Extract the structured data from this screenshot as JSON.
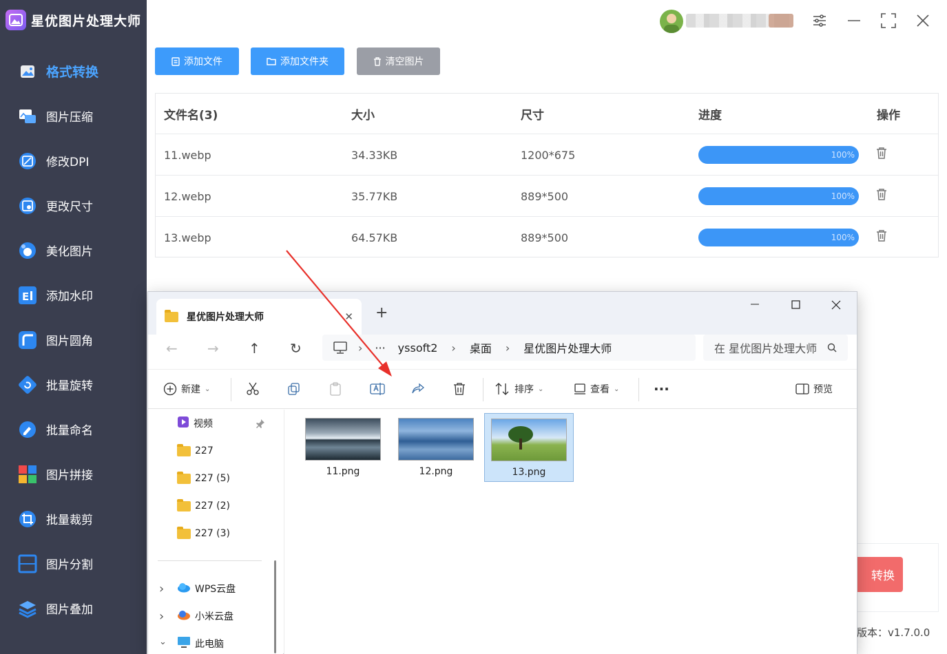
{
  "app": {
    "title": "星优图片处理大师"
  },
  "sidebar": {
    "items": [
      {
        "label": "格式转换",
        "active": true,
        "icon": "image-convert-icon",
        "color": "#3b8ff5"
      },
      {
        "label": "图片压缩",
        "icon": "compress-icon",
        "color": "#3b8ff5"
      },
      {
        "label": "修改DPI",
        "icon": "dpi-icon",
        "color": "#2d87f0"
      },
      {
        "label": "更改尺寸",
        "icon": "resize-icon",
        "color": "#2d87f0"
      },
      {
        "label": "美化图片",
        "icon": "beautify-icon",
        "color": "#2d87f0"
      },
      {
        "label": "添加水印",
        "icon": "watermark-icon",
        "color": "#2d87f0"
      },
      {
        "label": "图片圆角",
        "icon": "round-corner-icon",
        "color": "#2d87f0"
      },
      {
        "label": "批量旋转",
        "icon": "rotate-icon",
        "color": "#2d87f0"
      },
      {
        "label": "批量命名",
        "icon": "rename-icon",
        "color": "#2d87f0"
      },
      {
        "label": "图片拼接",
        "icon": "splice-icon",
        "color": "#f04a4a"
      },
      {
        "label": "批量裁剪",
        "icon": "crop-icon",
        "color": "#2d87f0"
      },
      {
        "label": "图片分割",
        "icon": "split-icon",
        "color": "#2d87f0"
      },
      {
        "label": "图片叠加",
        "icon": "layers-icon",
        "color": "#2d87f0"
      }
    ]
  },
  "toolbar": {
    "add_file": "添加文件",
    "add_folder": "添加文件夹",
    "clear": "清空图片"
  },
  "table": {
    "headers": [
      "文件名(3)",
      "大小",
      "尺寸",
      "进度",
      "操作"
    ],
    "rows": [
      {
        "name": "11.webp",
        "size": "34.33KB",
        "dims": "1200*675",
        "progress": "100%"
      },
      {
        "name": "12.webp",
        "size": "35.77KB",
        "dims": "889*500",
        "progress": "100%"
      },
      {
        "name": "13.webp",
        "size": "64.57KB",
        "dims": "889*500",
        "progress": "100%"
      }
    ]
  },
  "convert_label": "转换",
  "version": "版本：v1.7.0.0",
  "explorer": {
    "tab_title": "星优图片处理大师",
    "new_tab": "+",
    "breadcrumb": [
      "yssoft2",
      "桌面",
      "星优图片处理大师"
    ],
    "search_placeholder": "在 星优图片处理大师",
    "cmd": {
      "new": "新建",
      "sort": "排序",
      "view": "查看",
      "preview": "预览"
    },
    "nav": [
      {
        "label": "视频"
      },
      {
        "label": "227"
      },
      {
        "label": "227 (5)"
      },
      {
        "label": "227 (2)"
      },
      {
        "label": "227 (3)"
      },
      {
        "label": "WPS云盘"
      },
      {
        "label": "小米云盘"
      },
      {
        "label": "此电脑"
      }
    ],
    "files": [
      {
        "name": "11.png"
      },
      {
        "name": "12.png"
      },
      {
        "name": "13.png",
        "selected": true
      }
    ]
  }
}
